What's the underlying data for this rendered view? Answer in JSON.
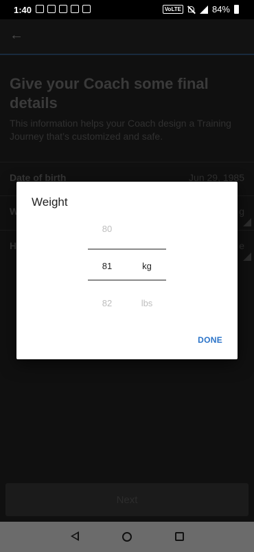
{
  "status_bar": {
    "time": "1:40",
    "network": "VoLTE",
    "battery": "84%"
  },
  "page": {
    "title": "Give your Coach some final details",
    "subtitle": "This information helps your Coach design a Training Journey that’s customized and safe.",
    "rows": [
      {
        "label": "Date of birth",
        "value": "Jun 29, 1985"
      },
      {
        "label": "W",
        "value": "g"
      },
      {
        "label": "H",
        "value": "e"
      }
    ],
    "next_label": "Next"
  },
  "dialog": {
    "title": "Weight",
    "numbers": [
      "80",
      "81",
      "82"
    ],
    "units": [
      "kg",
      "lbs"
    ],
    "done_label": "DONE"
  }
}
